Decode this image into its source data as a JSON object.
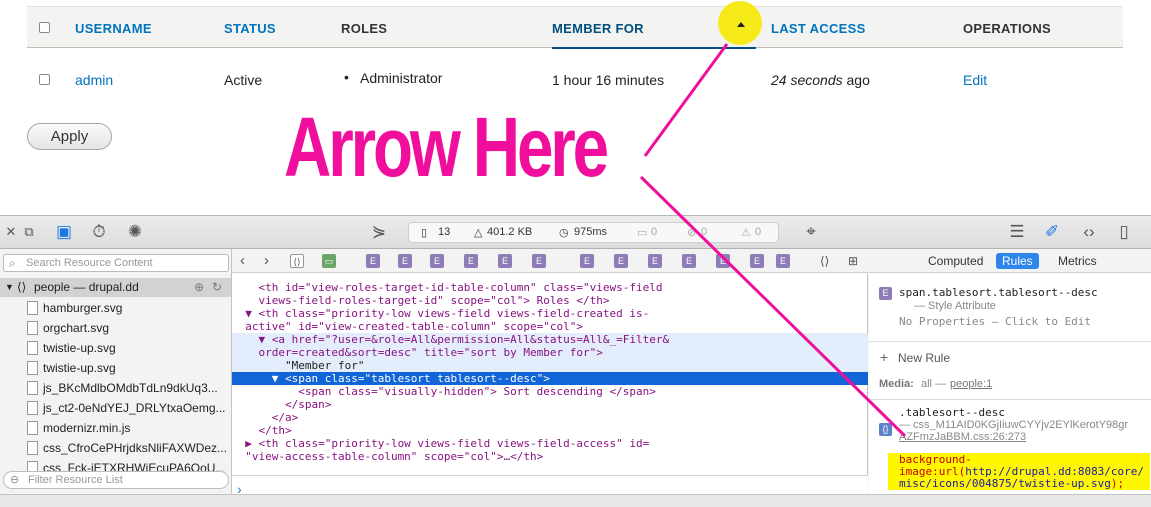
{
  "table": {
    "headers": {
      "username": "USERNAME",
      "status": "STATUS",
      "roles": "ROLES",
      "member_for": "MEMBER FOR",
      "last_access": "LAST ACCESS",
      "operations": "OPERATIONS"
    },
    "row": {
      "username": "admin",
      "status": "Active",
      "role": "Administrator",
      "member_for": "1 hour 16 minutes",
      "last_access_em": "24 seconds",
      "last_access_suffix": " ago",
      "operation": "Edit"
    },
    "apply_label": "Apply"
  },
  "annotation": {
    "text": "Arrow Here",
    "color": "#ef0f9c",
    "highlight_color": "#f7ea1a"
  },
  "inspector": {
    "activity": {
      "resources": "13",
      "size": "401.2 KB",
      "time": "975ms",
      "logs": "0",
      "errors": "0",
      "warnings": "0"
    },
    "sidebar": {
      "search_placeholder": "Search Resource Content",
      "root": "people — drupal.dd",
      "files": [
        "hamburger.svg",
        "orgchart.svg",
        "twistie-up.svg",
        "twistie-up.svg",
        "js_BKcMdlbOMdbTdLn9dkUq3...",
        "js_ct2-0eNdYEJ_DRLYtxaOemg...",
        "modernizr.min.js",
        "css_CfroCePHrjdksNliFAXWDez...",
        "css_Fck-iETXRHWiEcuPA6OoU..."
      ],
      "filter_placeholder": "Filter Resource List"
    },
    "code": [
      "    <th id=\"view-roles-target-id-table-column\" class=\"views-field",
      "    views-field-roles-target-id\" scope=\"col\"> Roles </th>",
      "  ▼ <th class=\"priority-low views-field views-field-created is-",
      "  active\" id=\"view-created-table-column\" scope=\"col\">",
      "    ▼ <a href=\"?user=&role=All&permission=All&status=All&_=Filter&",
      "    order=created&sort=desc\" title=\"sort by Member for\">",
      "        \"Member for\"",
      "      ▼ <span class=\"tablesort tablesort--desc\">",
      "          <span class=\"visually-hidden\"> Sort descending </span>",
      "        </span>",
      "      </a>",
      "    </th>",
      "  ▶ <th class=\"priority-low views-field views-field-access\" id=",
      "  \"view-access-table-column\" scope=\"col\">…</th>"
    ],
    "right": {
      "tabs": [
        "Computed",
        "Rules",
        "Metrics"
      ],
      "active_tab": "Rules",
      "style_selector": "span.tablesort.tablesort--desc",
      "style_origin": "— Style Attribute",
      "no_properties": "No Properties — Click to Edit",
      "new_rule": "New Rule",
      "media_label": "Media:",
      "media_value": "all — ",
      "media_link": "people:1",
      "rule_selector": ".tablesort--desc",
      "rule_source_1": "— css_M11AID0KGjIiuwCYYjv2EYlKerotY98gr",
      "rule_source_2": "AZFmzJaBBM.css:26:273",
      "decl_1": "background-",
      "decl_2_prefix": "image:url(",
      "decl_2_url": "http://drupal.dd:8083/core/",
      "decl_3_url": "misc/icons/004875/twistie-up.svg",
      "decl_3_suffix": ");"
    }
  }
}
